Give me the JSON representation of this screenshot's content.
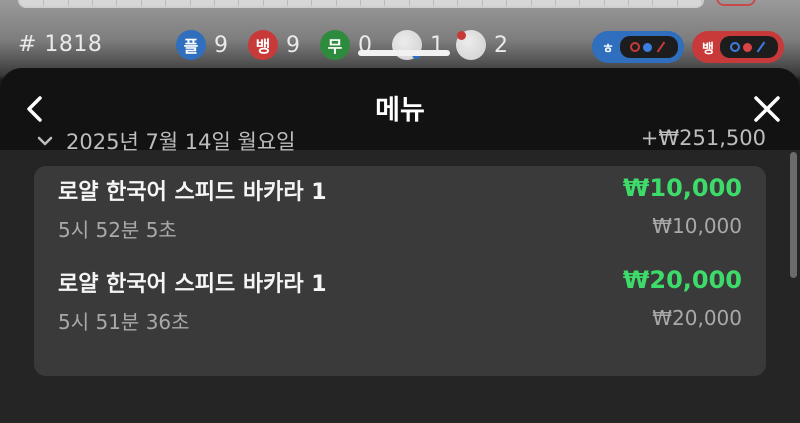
{
  "game_bar": {
    "round_number": "# 1818",
    "stats": [
      {
        "label": "플",
        "count": "9",
        "color": "#2f6fbd"
      },
      {
        "label": "뱅",
        "count": "9",
        "color": "#c83a3a"
      },
      {
        "label": "무",
        "count": "0",
        "color": "#2e8b3e"
      }
    ],
    "pairs": [
      {
        "count": "1",
        "dot_color": "#2f6fbd",
        "icon": "player-pair-icon"
      },
      {
        "count": "2",
        "dot_color": "#c83a3a",
        "icon": "banker-pair-icon"
      }
    ],
    "predictions": [
      {
        "label": "ㅎ",
        "color": "#2f6fbd"
      },
      {
        "label": "뱅",
        "color": "#c83a3a"
      }
    ]
  },
  "menu": {
    "title": "메뉴",
    "back_icon": "chevron-left-icon",
    "close_icon": "close-icon"
  },
  "history": {
    "date_label": "2025년 7월 14일 월요일",
    "day_total": "+₩251,500",
    "items": [
      {
        "game": "로얄 한국어 스피드 바카라 1",
        "win_amount": "₩10,000",
        "time": "5시 52분 5초",
        "stake": "₩10,000"
      },
      {
        "game": "로얄 한국어 스피드 바카라 1",
        "win_amount": "₩20,000",
        "time": "5시 51분 36초",
        "stake": "₩20,000"
      }
    ]
  },
  "colors": {
    "win_green": "#3ddc6a",
    "player_blue": "#2f6fbd",
    "banker_red": "#c83a3a",
    "tie_green": "#2e8b3e"
  }
}
